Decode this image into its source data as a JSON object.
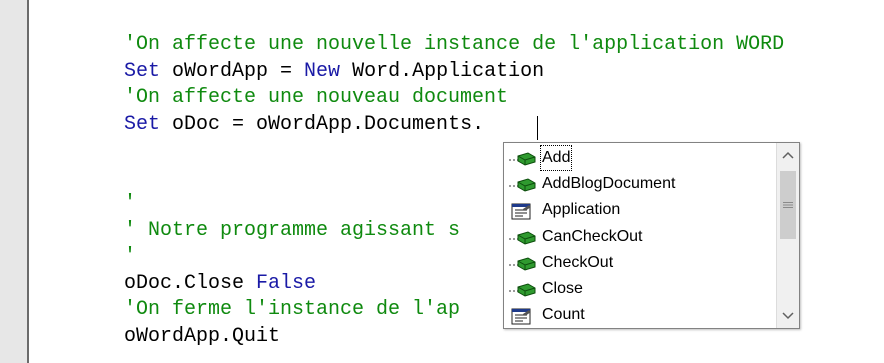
{
  "editor": {
    "lines": [
      {
        "parts": [
          {
            "t": "'On affecte une nouvelle instance de l'application WORD",
            "c": "cm"
          }
        ]
      },
      {
        "parts": [
          {
            "t": "Set",
            "c": "kw"
          },
          {
            "t": " oWordApp = ",
            "c": ""
          },
          {
            "t": "New",
            "c": "kw"
          },
          {
            "t": " Word.Application",
            "c": ""
          }
        ]
      },
      {
        "parts": [
          {
            "t": "'On affecte une nouveau document",
            "c": "cm"
          }
        ]
      },
      {
        "parts": [
          {
            "t": "Set",
            "c": "kw"
          },
          {
            "t": " oDoc = oWordApp.Documents.",
            "c": ""
          }
        ]
      },
      {
        "parts": []
      },
      {
        "parts": []
      },
      {
        "parts": [
          {
            "t": "'",
            "c": "cm"
          }
        ]
      },
      {
        "parts": [
          {
            "t": "' Notre programme agissant s",
            "c": "cm"
          }
        ]
      },
      {
        "parts": [
          {
            "t": "'",
            "c": "cm"
          }
        ]
      },
      {
        "parts": [
          {
            "t": "oDoc.Close ",
            "c": ""
          },
          {
            "t": "False",
            "c": "kw"
          }
        ]
      },
      {
        "parts": [
          {
            "t": "'On ferme l'instance de l'ap",
            "c": "cm"
          }
        ]
      },
      {
        "parts": [
          {
            "t": "oWordApp.Quit",
            "c": ""
          }
        ]
      }
    ]
  },
  "autocomplete": {
    "items": [
      {
        "label": "Add",
        "icon": "method-icon",
        "selected": true
      },
      {
        "label": "AddBlogDocument",
        "icon": "method-icon",
        "selected": false
      },
      {
        "label": "Application",
        "icon": "property-icon",
        "selected": false
      },
      {
        "label": "CanCheckOut",
        "icon": "method-icon",
        "selected": false
      },
      {
        "label": "CheckOut",
        "icon": "method-icon",
        "selected": false
      },
      {
        "label": "Close",
        "icon": "method-icon",
        "selected": false
      },
      {
        "label": "Count",
        "icon": "property-icon",
        "selected": false
      }
    ],
    "scrollbar": {
      "up": "scroll-up-icon",
      "down": "scroll-down-icon"
    }
  },
  "colors": {
    "keyword": "#1a1aa6",
    "comment": "#0f8a0f",
    "text": "#000000",
    "gutter": "#e7e7e7"
  }
}
